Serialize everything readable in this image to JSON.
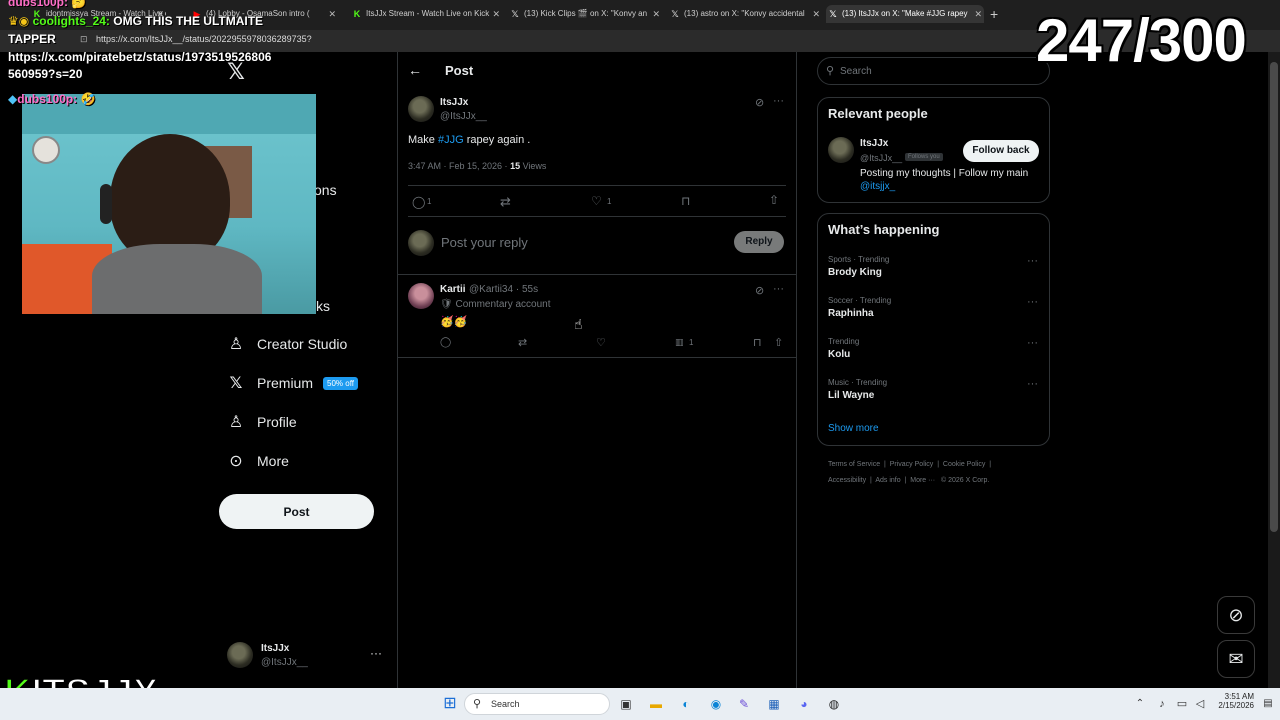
{
  "browser": {
    "tabs": [
      {
        "label": "idontmissya Stream - Watch Live o",
        "icon": "kick-icon"
      },
      {
        "label": "(4) Lobby - OsamaSon intro (",
        "icon": "youtube-icon"
      },
      {
        "label": "ItsJJx Stream - Watch Live on Kick",
        "icon": "kick-icon"
      },
      {
        "label": "(13) Kick Clips 🎬 on X: \"Konvy an",
        "icon": "x-icon"
      },
      {
        "label": "(13) astro on X: \"Konvy accidental",
        "icon": "x-icon"
      },
      {
        "label": "(13) ItsJJx on X: \"Make #JJG rapey",
        "icon": "x-icon",
        "active": true
      }
    ],
    "url": "https://x.com/ItsJJx__/status/2022955978036289735?"
  },
  "overlay": {
    "counter": "247/300",
    "chat": [
      {
        "user": "dubs100p:",
        "text": "🤔"
      },
      {
        "user": "coolights_24:",
        "text": "OMG THIS THE ULTMAITE"
      },
      {
        "user": "TAPPER",
        "text": ""
      },
      {
        "user": "",
        "text": "https://x.com/piratebetz/status/1973519526806"
      },
      {
        "user": "",
        "text": "560959?s=20"
      },
      {
        "user": "dubs100p:",
        "text": "🤣"
      }
    ],
    "kick_brand": "ITSJJX"
  },
  "nav": {
    "items": [
      {
        "label": "Creator Studio",
        "icon": "flask-icon"
      },
      {
        "label": "Premium",
        "icon": "x-premium-icon",
        "badge": "50% off"
      },
      {
        "label": "Profile",
        "icon": "person-icon"
      },
      {
        "label": "More",
        "icon": "more-circle-icon"
      }
    ],
    "partial_labels": {
      "notifications": "ons",
      "bookmarks": "ks"
    },
    "post_label": "Post",
    "account": {
      "name": "ItsJJx",
      "handle": "@ItsJJx__"
    }
  },
  "main": {
    "header": "Post",
    "tweet": {
      "name": "ItsJJx",
      "handle": "@ItsJJx__",
      "text_prefix": "Make ",
      "hashtag": "#JJG",
      "text_suffix": " rapey again .",
      "time": "3:47 AM · Feb 15, 2026 · ",
      "views_count": "15",
      "views_label": " Views",
      "replies": "1",
      "likes": "1"
    },
    "reply_placeholder": "Post your reply",
    "reply_button": "Reply",
    "reply": {
      "name": "Kartii",
      "handle": "@Kartii34 · 55s",
      "bio": "🛡 Commentary account",
      "text": "🥳🥳",
      "views": "1"
    }
  },
  "sidebar": {
    "search_placeholder": "Search",
    "relevant": {
      "title": "Relevant people",
      "name": "ItsJJx",
      "handle": "@ItsJJx__",
      "follows_you": "Follows you",
      "follow_label": "Follow back",
      "bio": "Posting my thoughts | Follow my main",
      "bio_link": "@itsjjx_"
    },
    "happening": {
      "title": "What’s happening",
      "trends": [
        {
          "category": "Sports · Trending",
          "name": "Brody King"
        },
        {
          "category": "Soccer · Trending",
          "name": "Raphinha"
        },
        {
          "category": "Trending",
          "name": "Kolu"
        },
        {
          "category": "Music · Trending",
          "name": "Lil Wayne"
        }
      ],
      "show_more": "Show more"
    },
    "footer": {
      "line1": [
        "Terms of Service",
        "Privacy Policy",
        "Cookie Policy"
      ],
      "line2": [
        "Accessibility",
        "Ads info",
        "More ···",
        "© 2026 X Corp."
      ]
    }
  },
  "taskbar": {
    "search": "Search",
    "time": "3:51 AM",
    "date": "2/15/2026"
  },
  "colors": {
    "accent": "#1d9bf0",
    "background": "#000000",
    "border": "#2f3336",
    "muted": "#71767b"
  }
}
